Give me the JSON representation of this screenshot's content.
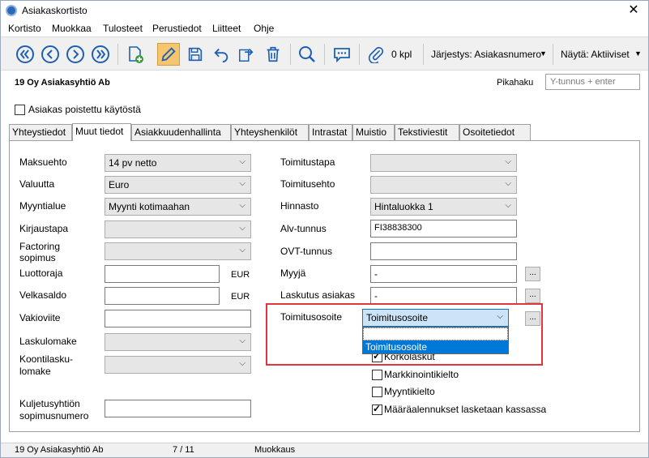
{
  "window": {
    "title": "Asiakaskortisto",
    "close_glyph": "✕"
  },
  "menu": [
    "Kortisto",
    "Muokkaa",
    "Tulosteet",
    "Perustiedot",
    "Liitteet",
    "Ohje"
  ],
  "toolbar": {
    "attachments_count": "0 kpl",
    "sort_label": "Järjestys: Asiakasnumero",
    "show_label": "Näytä: Aktiiviset",
    "icons": [
      "first-icon",
      "prev-icon",
      "next-icon",
      "last-icon",
      "new-document-icon",
      "edit-pencil-icon",
      "save-icon",
      "undo-icon",
      "transfer-icon",
      "delete-icon",
      "search-icon",
      "comment-icon",
      "attachment-icon"
    ]
  },
  "header": {
    "company": "19  Oy Asiakasyhtiö Ab",
    "pikahaku_label": "Pikahaku",
    "pikahaku_placeholder": "Y-tunnus + enter",
    "removed_checkbox_label": "Asiakas poistettu käytöstä"
  },
  "tabs": [
    {
      "label": "Yhteystiedot",
      "active": false
    },
    {
      "label": "Muut tiedot",
      "active": true
    },
    {
      "label": "Asiakkuudenhallinta",
      "active": false
    },
    {
      "label": "Yhteyshenkilöt",
      "active": false
    },
    {
      "label": "Intrastat",
      "active": false
    },
    {
      "label": "Muistio",
      "active": false
    },
    {
      "label": "Tekstiviestit",
      "active": false
    },
    {
      "label": "Osoitetiedot",
      "active": false
    }
  ],
  "left_fields": {
    "maksuehto": {
      "label": "Maksuehto",
      "value": "14 pv netto"
    },
    "valuutta": {
      "label": "Valuutta",
      "value": "Euro"
    },
    "myyntialue": {
      "label": "Myyntialue",
      "value": "Myynti kotimaahan"
    },
    "kirjaustapa": {
      "label": "Kirjaustapa",
      "value": ""
    },
    "factoring": {
      "label_line1": "Factoring",
      "label_line2": "sopimus",
      "value": ""
    },
    "luottoraja": {
      "label": "Luottoraja",
      "value": "",
      "unit": "EUR"
    },
    "velkasaldo": {
      "label": "Velkasaldo",
      "value": "",
      "unit": "EUR"
    },
    "vakioviite": {
      "label": "Vakioviite",
      "value": ""
    },
    "laskulomake": {
      "label": "Laskulomake",
      "value": ""
    },
    "koontilasku": {
      "label_line1": "Koontilasku-",
      "label_line2": "lomake",
      "value": ""
    },
    "kuljetus": {
      "label_line1": "Kuljetusyhtiön",
      "label_line2": "sopimusnumero",
      "value": ""
    }
  },
  "right_fields": {
    "toimitustapa": {
      "label": "Toimitustapa",
      "value": ""
    },
    "toimitusehto": {
      "label": "Toimitusehto",
      "value": ""
    },
    "hinnasto": {
      "label": "Hinnasto",
      "value": "Hintaluokka 1"
    },
    "alv": {
      "label": "Alv-tunnus",
      "value": "FI38838300"
    },
    "ovt": {
      "label": "OVT-tunnus",
      "value": ""
    },
    "myyja": {
      "label": "Myyjä",
      "value": "-"
    },
    "laskutus": {
      "label": "Laskutus asiakas",
      "value": "-"
    },
    "toimitusosoite": {
      "label": "Toimitusosoite",
      "value": "Toimitusosoite",
      "options": [
        "",
        "Toimitusosoite"
      ]
    }
  },
  "dotbtn_label": "...",
  "checkboxes": [
    {
      "label": "Korkolaskut",
      "checked": true
    },
    {
      "label": "Markkinointikielto",
      "checked": false
    },
    {
      "label": "Myyntikielto",
      "checked": false
    },
    {
      "label": "Määräalennukset lasketaan kassassa",
      "checked": true
    }
  ],
  "status": {
    "company": "19  Oy Asiakasyhtiö Ab",
    "record": "7 / 11",
    "mode": "Muokkaus"
  },
  "colors": {
    "accent": "#0078d7",
    "highlight": "#e2363c",
    "active_tool": "#f6c66e"
  }
}
